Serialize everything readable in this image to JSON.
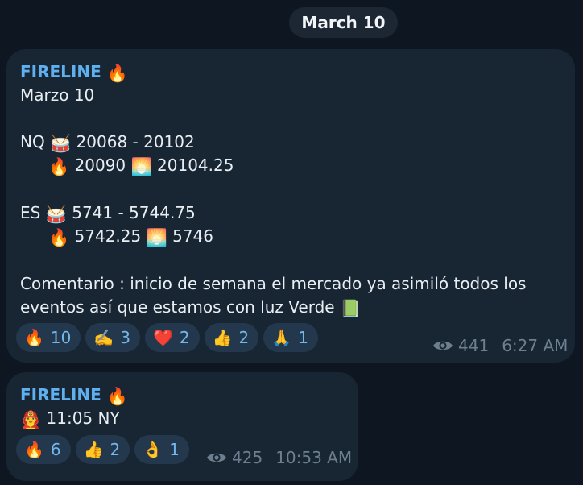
{
  "date_label": "March 10",
  "messages": [
    {
      "sender": "FIRELINE",
      "sender_emoji": "🔥",
      "lines": {
        "date": "Marzo 10",
        "nq_prefix": "NQ",
        "nq_range": "20068 - 20102",
        "nq_fire": "20090",
        "nq_sunset": "20104.25",
        "es_prefix": "ES",
        "es_range": "5741 - 5744.75",
        "es_fire": "5742.25",
        "es_sunset": "5746",
        "comment_1": "Comentario : inicio de semana el mercado ya asimiló todos los",
        "comment_2": "eventos así que estamos con luz Verde"
      },
      "icons": {
        "drum": "🥁",
        "fire": "🔥",
        "sunset": "🌅",
        "book": "📗"
      },
      "reactions": [
        {
          "emoji": "🔥",
          "count": "10"
        },
        {
          "emoji": "✍️",
          "count": "3"
        },
        {
          "emoji": "❤️",
          "count": "2"
        },
        {
          "emoji": "👍",
          "count": "2"
        },
        {
          "emoji": "🙏",
          "count": "1"
        }
      ],
      "views": "441",
      "time": "6:27 AM"
    },
    {
      "sender": "FIRELINE",
      "sender_emoji": "🔥",
      "lines": {
        "firefighter": "👨‍🚒",
        "time_note": "11:05 NY"
      },
      "reactions": [
        {
          "emoji": "🔥",
          "count": "6"
        },
        {
          "emoji": "👍",
          "count": "2"
        },
        {
          "emoji": "👌",
          "count": "1"
        }
      ],
      "views": "425",
      "time": "10:53 AM"
    }
  ],
  "colors": {
    "background": "#0e1621",
    "bubble": "#182533",
    "sender": "#5fb0ef",
    "reaction_bg": "#24384d",
    "reaction_text": "#72b8ee",
    "meta": "#6d7f8f"
  }
}
